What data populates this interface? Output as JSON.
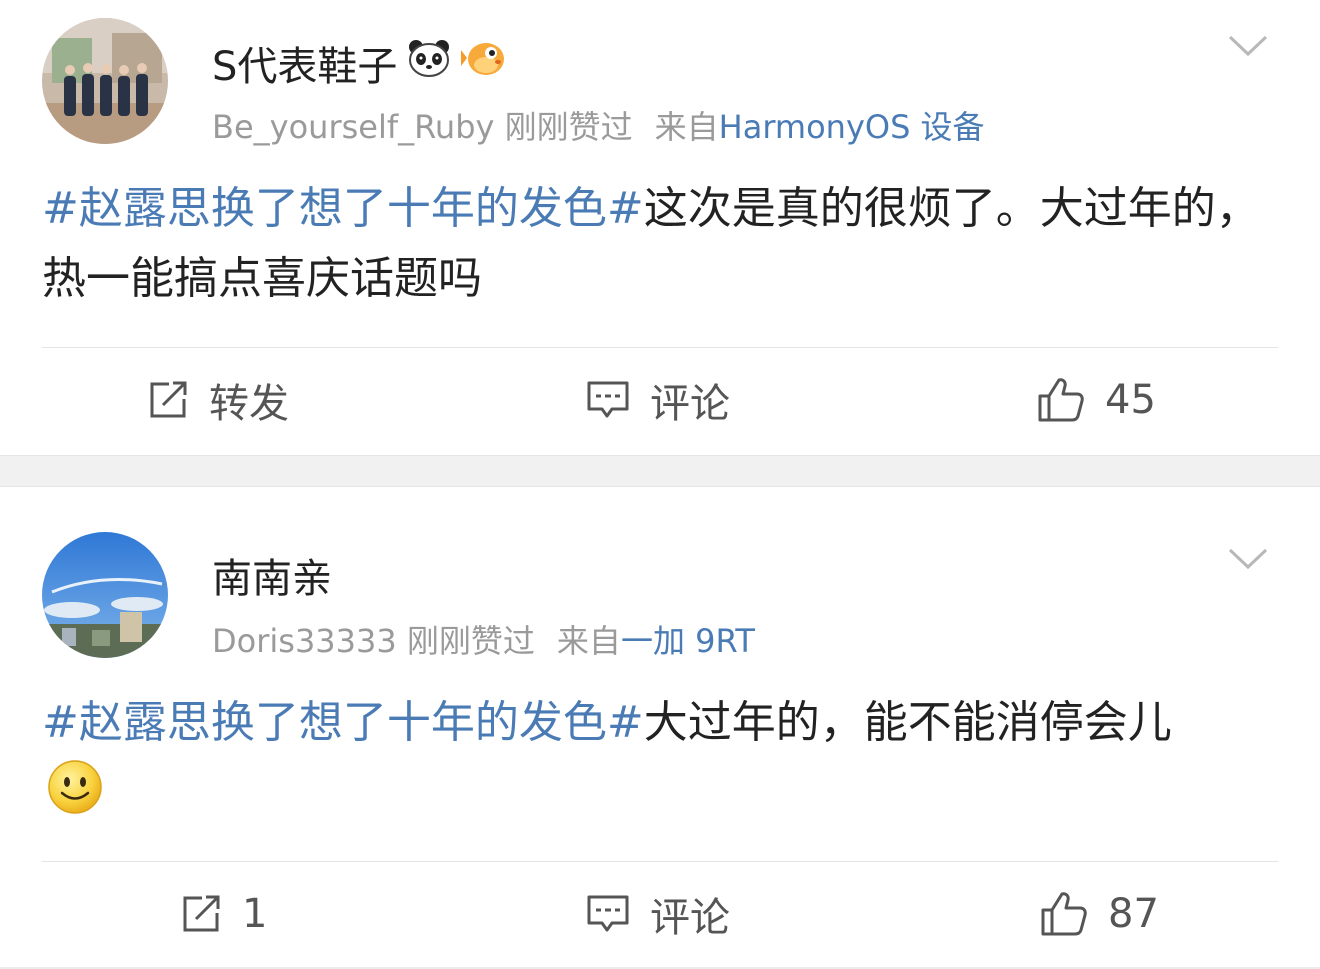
{
  "posts": [
    {
      "username": "S代表鞋子",
      "badges": [
        "panda-icon",
        "pufferfish-icon"
      ],
      "liker": "Be_yourself_Ruby",
      "liked_text": "刚刚赞过",
      "from_label": "来自",
      "device": "HarmonyOS 设备",
      "hashtag": "#赵露思换了想了十年的发色#",
      "body": "这次是真的很烦了。大过年的，热一能搞点喜庆话题吗",
      "repost_label": "转发",
      "comment_label": "评论",
      "like_count": "45"
    },
    {
      "username": "南南亲",
      "liker": "Doris33333",
      "liked_text": "刚刚赞过",
      "from_label": "来自",
      "device": "一加 9RT",
      "hashtag": "#赵露思换了想了十年的发色#",
      "body": "大过年的，能不能消停会儿",
      "emoji": "smiley-emoji",
      "repost_count": "1",
      "comment_label": "评论",
      "like_count": "87"
    }
  ],
  "colors": {
    "link": "#4a7bb5",
    "meta": "#9a9a9a",
    "text": "#222222",
    "separator": "#f1f1f1"
  }
}
